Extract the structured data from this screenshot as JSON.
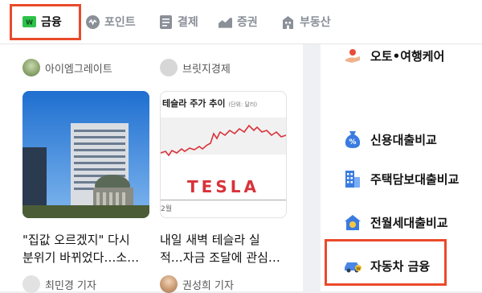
{
  "nav": {
    "tabs": [
      {
        "label": "금융",
        "icon": "finance-icon",
        "active": true
      },
      {
        "label": "포인트",
        "icon": "point-icon",
        "active": false
      },
      {
        "label": "결제",
        "icon": "payment-icon",
        "active": false
      },
      {
        "label": "증권",
        "icon": "stock-icon",
        "active": false
      },
      {
        "label": "부동산",
        "icon": "realestate-icon",
        "active": false
      }
    ]
  },
  "articles": [
    {
      "source": "아이엠그레이트",
      "headline_line1": "\"집값 오르겠지\" 다시",
      "headline_line2": "분위기 바뀌었다…소…",
      "author": "최민경 기자"
    },
    {
      "source": "브릿지경제",
      "chart_title": "테슬라 주가 추이",
      "chart_unit": "(단위: 달러)",
      "chart_logo": "TESLA",
      "chart_xtick": "2월",
      "headline_line1": "내일 새벽 테슬라 실",
      "headline_line2": "적…자금 조달에 관심…",
      "author": "권성희 기자"
    }
  ],
  "sidebar": {
    "items": [
      {
        "label": "오토•여행케어",
        "icon": "travel-care-icon"
      },
      {
        "label": "신용대출비교",
        "icon": "credit-loan-icon"
      },
      {
        "label": "주택담보대출비교",
        "icon": "mortgage-icon"
      },
      {
        "label": "전월세대출비교",
        "icon": "rent-loan-icon"
      },
      {
        "label": "자동차 금융",
        "icon": "car-finance-icon"
      }
    ]
  },
  "colors": {
    "highlight": "#ea4a2b",
    "finance_green": "#2ec24a",
    "chart_red": "#d9323a"
  }
}
